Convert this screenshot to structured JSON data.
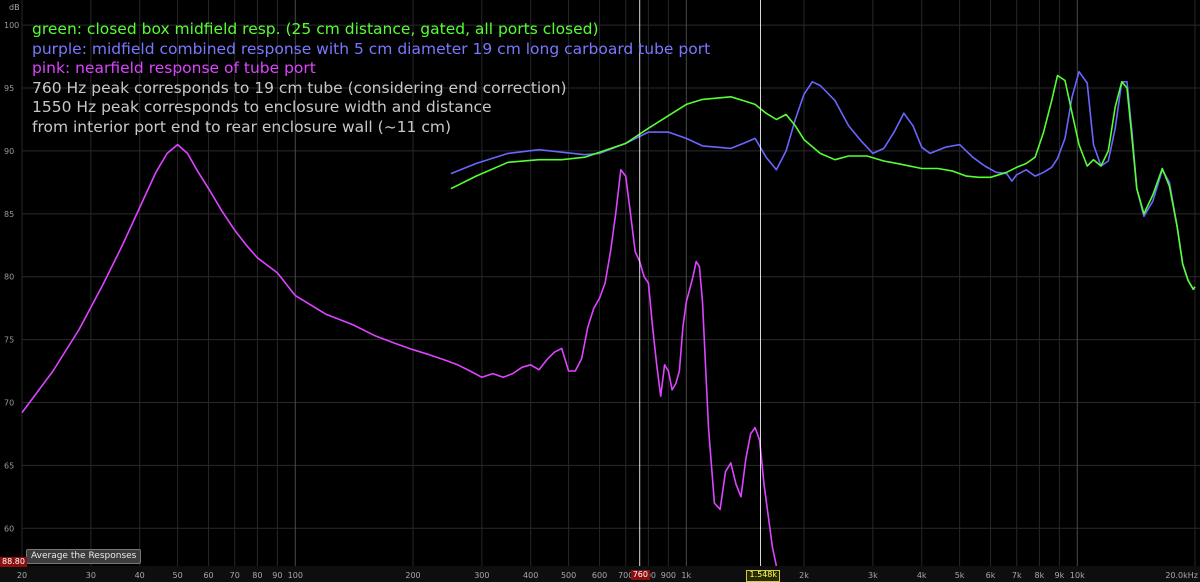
{
  "chart_data": {
    "type": "line",
    "ylabel": "dB",
    "xlabel": "",
    "x_scale": "log",
    "xlim": [
      20,
      20000
    ],
    "ylim": [
      57,
      102
    ],
    "y_ticks": [
      60,
      65,
      70,
      75,
      80,
      85,
      90,
      95,
      100
    ],
    "x_ticks": [
      {
        "value": 20,
        "label": "20"
      },
      {
        "value": 30,
        "label": "30"
      },
      {
        "value": 40,
        "label": "40"
      },
      {
        "value": 50,
        "label": "50"
      },
      {
        "value": 60,
        "label": "60"
      },
      {
        "value": 70,
        "label": "70"
      },
      {
        "value": 80,
        "label": "80"
      },
      {
        "value": 90,
        "label": "90"
      },
      {
        "value": 100,
        "label": "100"
      },
      {
        "value": 200,
        "label": "200"
      },
      {
        "value": 300,
        "label": "300"
      },
      {
        "value": 400,
        "label": "400"
      },
      {
        "value": 500,
        "label": "500"
      },
      {
        "value": 600,
        "label": "600"
      },
      {
        "value": 700,
        "label": "700"
      },
      {
        "value": 800,
        "label": "800"
      },
      {
        "value": 900,
        "label": "900"
      },
      {
        "value": 1000,
        "label": "1k"
      },
      {
        "value": 2000,
        "label": "2k"
      },
      {
        "value": 3000,
        "label": "3k"
      },
      {
        "value": 4000,
        "label": "4k"
      },
      {
        "value": 5000,
        "label": "5k"
      },
      {
        "value": 6000,
        "label": "6k"
      },
      {
        "value": 7000,
        "label": "7k"
      },
      {
        "value": 8000,
        "label": "8k"
      },
      {
        "value": 9000,
        "label": "9k"
      },
      {
        "value": 10000,
        "label": "10k"
      },
      {
        "value": 20000,
        "label": "20.0kHz"
      }
    ],
    "cursors": [
      {
        "x": 760,
        "label": "760",
        "color": "#ffffff"
      },
      {
        "x": 1548,
        "label": "1.548k",
        "color": "#ffffff"
      }
    ],
    "y_readout": "88.80",
    "grid": true,
    "series": [
      {
        "color": "#55ff33",
        "points": [
          [
            250,
            87
          ],
          [
            290,
            88
          ],
          [
            350,
            89.1
          ],
          [
            420,
            89.3
          ],
          [
            480,
            89.3
          ],
          [
            550,
            89.5
          ],
          [
            600,
            89.9
          ],
          [
            700,
            90.6
          ],
          [
            800,
            91.8
          ],
          [
            900,
            92.8
          ],
          [
            1000,
            93.7
          ],
          [
            1100,
            94.1
          ],
          [
            1200,
            94.2
          ],
          [
            1300,
            94.3
          ],
          [
            1400,
            94.0
          ],
          [
            1500,
            93.7
          ],
          [
            1600,
            93.0
          ],
          [
            1700,
            92.5
          ],
          [
            1800,
            92.9
          ],
          [
            1900,
            92.0
          ],
          [
            2000,
            90.9
          ],
          [
            2200,
            89.8
          ],
          [
            2400,
            89.3
          ],
          [
            2600,
            89.6
          ],
          [
            2900,
            89.6
          ],
          [
            3200,
            89.2
          ],
          [
            3600,
            88.9
          ],
          [
            4000,
            88.6
          ],
          [
            4400,
            88.6
          ],
          [
            4800,
            88.4
          ],
          [
            5200,
            88.0
          ],
          [
            5600,
            87.9
          ],
          [
            6000,
            87.9
          ],
          [
            6600,
            88.3
          ],
          [
            7000,
            88.7
          ],
          [
            7400,
            89.0
          ],
          [
            7800,
            89.5
          ],
          [
            8200,
            91.5
          ],
          [
            8600,
            94
          ],
          [
            8900,
            96.0
          ],
          [
            9300,
            95.6
          ],
          [
            9700,
            93
          ],
          [
            10100,
            90.5
          ],
          [
            10600,
            88.8
          ],
          [
            11000,
            89.3
          ],
          [
            11500,
            88.8
          ],
          [
            12000,
            90
          ],
          [
            12500,
            93.5
          ],
          [
            13000,
            95.5
          ],
          [
            13400,
            95
          ],
          [
            13800,
            91
          ],
          [
            14200,
            87
          ],
          [
            14800,
            85
          ],
          [
            15600,
            86.5
          ],
          [
            16500,
            88.6
          ],
          [
            17200,
            87.2
          ],
          [
            18000,
            84
          ],
          [
            18600,
            81
          ],
          [
            19200,
            79.7
          ],
          [
            19800,
            79
          ],
          [
            20000,
            79.2
          ],
          [
            20500,
            78.3
          ],
          [
            21000,
            76
          ],
          [
            21600,
            73.4
          ],
          [
            22100,
            73.2
          ],
          [
            22600,
            75
          ],
          [
            23000,
            77.5
          ],
          [
            23500,
            80.5
          ],
          [
            24000,
            83
          ],
          [
            24500,
            83.8
          ],
          [
            25000,
            83.5
          ],
          [
            25500,
            81.3
          ]
        ]
      },
      {
        "color": "#6a66ff",
        "points": [
          [
            250,
            88.2
          ],
          [
            290,
            89
          ],
          [
            350,
            89.8
          ],
          [
            420,
            90.1
          ],
          [
            480,
            89.9
          ],
          [
            550,
            89.7
          ],
          [
            600,
            89.8
          ],
          [
            700,
            90.6
          ],
          [
            800,
            91.5
          ],
          [
            900,
            91.5
          ],
          [
            1000,
            91.0
          ],
          [
            1100,
            90.4
          ],
          [
            1200,
            90.3
          ],
          [
            1300,
            90.2
          ],
          [
            1400,
            90.6
          ],
          [
            1500,
            91
          ],
          [
            1600,
            89.5
          ],
          [
            1700,
            88.5
          ],
          [
            1800,
            90
          ],
          [
            1900,
            92.5
          ],
          [
            2000,
            94.5
          ],
          [
            2100,
            95.5
          ],
          [
            2200,
            95.2
          ],
          [
            2400,
            94
          ],
          [
            2600,
            92
          ],
          [
            2800,
            90.8
          ],
          [
            3000,
            89.8
          ],
          [
            3200,
            90.2
          ],
          [
            3400,
            91.5
          ],
          [
            3600,
            93.0
          ],
          [
            3800,
            92
          ],
          [
            4000,
            90.3
          ],
          [
            4200,
            89.8
          ],
          [
            4600,
            90.3
          ],
          [
            5000,
            90.5
          ],
          [
            5400,
            89.5
          ],
          [
            5800,
            88.8
          ],
          [
            6200,
            88.3
          ],
          [
            6600,
            88.2
          ],
          [
            6800,
            87.6
          ],
          [
            7000,
            88.1
          ],
          [
            7400,
            88.5
          ],
          [
            7800,
            88.0
          ],
          [
            8200,
            88.3
          ],
          [
            8600,
            88.7
          ],
          [
            8900,
            89.4
          ],
          [
            9300,
            91
          ],
          [
            9700,
            94.3
          ],
          [
            10100,
            96.3
          ],
          [
            10600,
            95.4
          ],
          [
            11000,
            90.5
          ],
          [
            11500,
            88.8
          ],
          [
            12000,
            89.2
          ],
          [
            12500,
            91.8
          ],
          [
            13000,
            95.5
          ],
          [
            13400,
            95.5
          ],
          [
            13800,
            91.5
          ],
          [
            14200,
            87
          ],
          [
            14800,
            84.8
          ],
          [
            15600,
            86
          ],
          [
            16500,
            88.5
          ],
          [
            17200,
            87.5
          ],
          [
            18000,
            84
          ],
          [
            18600,
            81
          ],
          [
            19200,
            79.7
          ],
          [
            19800,
            79
          ],
          [
            20000,
            79.2
          ],
          [
            20500,
            78.3
          ],
          [
            21000,
            76
          ],
          [
            21600,
            73.3
          ],
          [
            22100,
            73.2
          ],
          [
            22600,
            75
          ],
          [
            23000,
            77.5
          ],
          [
            23500,
            80.5
          ],
          [
            24000,
            83
          ],
          [
            24500,
            83.8
          ],
          [
            25000,
            83.5
          ],
          [
            25500,
            81.3
          ]
        ]
      },
      {
        "color": "#dd44ff",
        "points": [
          [
            20,
            69.2
          ],
          [
            24,
            72.5
          ],
          [
            28,
            75.8
          ],
          [
            32,
            79.2
          ],
          [
            36,
            82.4
          ],
          [
            40,
            85.5
          ],
          [
            44,
            88.3
          ],
          [
            47,
            89.8
          ],
          [
            50,
            90.5
          ],
          [
            53,
            89.8
          ],
          [
            56,
            88.5
          ],
          [
            60,
            87.0
          ],
          [
            65,
            85.2
          ],
          [
            70,
            83.7
          ],
          [
            75,
            82.5
          ],
          [
            80,
            81.5
          ],
          [
            90,
            80.3
          ],
          [
            100,
            78.5
          ],
          [
            120,
            77
          ],
          [
            140,
            76.2
          ],
          [
            160,
            75.3
          ],
          [
            180,
            74.7
          ],
          [
            200,
            74.2
          ],
          [
            220,
            73.8
          ],
          [
            240,
            73.4
          ],
          [
            260,
            73.0
          ],
          [
            280,
            72.5
          ],
          [
            300,
            72.0
          ],
          [
            320,
            72.3
          ],
          [
            340,
            72.0
          ],
          [
            360,
            72.3
          ],
          [
            380,
            72.8
          ],
          [
            400,
            73.0
          ],
          [
            420,
            72.6
          ],
          [
            440,
            73.4
          ],
          [
            460,
            74.0
          ],
          [
            480,
            74.3
          ],
          [
            500,
            72.5
          ],
          [
            520,
            72.5
          ],
          [
            540,
            73.5
          ],
          [
            560,
            76
          ],
          [
            580,
            77.5
          ],
          [
            600,
            78.3
          ],
          [
            620,
            79.5
          ],
          [
            640,
            82
          ],
          [
            660,
            85
          ],
          [
            680,
            88.5
          ],
          [
            700,
            88
          ],
          [
            720,
            85
          ],
          [
            740,
            82
          ],
          [
            760,
            81.2
          ],
          [
            780,
            80.0
          ],
          [
            800,
            79.5
          ],
          [
            820,
            76
          ],
          [
            840,
            73
          ],
          [
            860,
            70.5
          ],
          [
            880,
            73
          ],
          [
            900,
            72.5
          ],
          [
            920,
            71
          ],
          [
            940,
            71.5
          ],
          [
            960,
            72.5
          ],
          [
            980,
            76
          ],
          [
            1000,
            78
          ],
          [
            1020,
            79
          ],
          [
            1040,
            80
          ],
          [
            1060,
            81.2
          ],
          [
            1080,
            80.8
          ],
          [
            1100,
            78
          ],
          [
            1140,
            68
          ],
          [
            1180,
            62
          ],
          [
            1220,
            61.5
          ],
          [
            1260,
            64.5
          ],
          [
            1300,
            65.2
          ],
          [
            1340,
            63.5
          ],
          [
            1380,
            62.5
          ],
          [
            1420,
            65.5
          ],
          [
            1460,
            67.5
          ],
          [
            1500,
            68
          ],
          [
            1540,
            67
          ],
          [
            1580,
            63.5
          ],
          [
            1620,
            61
          ],
          [
            1660,
            58.5
          ],
          [
            1700,
            57
          ]
        ]
      }
    ]
  },
  "annotations": [
    {
      "text": "green: closed box midfield resp. (25 cm distance, gated, all ports closed)",
      "color": "#55ff33"
    },
    {
      "text": "purple: midfield combined response with 5 cm diameter 19 cm long carboard tube port",
      "color": "#7a77ff"
    },
    {
      "text": "pink: nearfield response of tube port",
      "color": "#dd44ff"
    },
    {
      "text": "760 Hz peak corresponds to 19 cm tube (considering end correction)",
      "color": "#c8c8c8"
    },
    {
      "text": "1550 Hz peak corresponds to enclosure width and distance",
      "color": "#c8c8c8"
    },
    {
      "text": "from interior port end to rear enclosure wall (~11 cm)",
      "color": "#c8c8c8"
    }
  ],
  "controls": {
    "average_button": "Average the Responses"
  }
}
